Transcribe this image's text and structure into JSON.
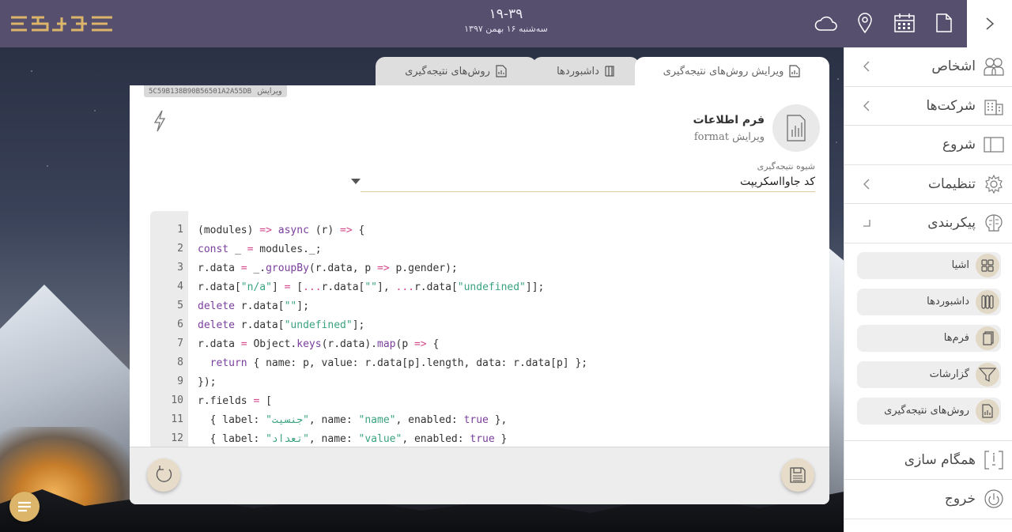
{
  "topbar": {
    "logo_text": "",
    "time": "۱۹-۳۹",
    "date": "سه‌شنبه ۱۶ بهمن ۱۳۹۷",
    "icons": [
      "document-icon",
      "calendar-icon",
      "location-pin-icon",
      "cloud-icon"
    ],
    "collapse_icon": "chevron-right-icon"
  },
  "tabs": [
    {
      "label": "ویرایش روش‌های نتیجه‌گیری",
      "icon": "report-edit-icon",
      "active": true
    },
    {
      "label": "داشبوردها",
      "icon": "dashboard-icon",
      "active": false
    },
    {
      "label": "روش‌های نتیجه‌گیری",
      "icon": "report-icon",
      "active": false
    }
  ],
  "panel": {
    "version_label": "ویرایش",
    "version_hash": "5C59B138B90B56501A2A55DB",
    "form_title": "فرم اطلاعات",
    "form_subtitle": "ویرایش format",
    "field_label": "شیوه نتیجه‌گیری",
    "field_value": "کد جاوااسکریپت"
  },
  "editor": {
    "line_numbers": [
      "1",
      "2",
      "3",
      "4",
      "5",
      "6",
      "7",
      "8",
      "9",
      "10",
      "11",
      "12"
    ]
  },
  "sidebar": {
    "items": [
      {
        "label": "اشخاص",
        "icon": "people-icon",
        "has_arrow": true
      },
      {
        "label": "شرکت‌ها",
        "icon": "building-icon",
        "has_arrow": true
      },
      {
        "label": "شروع",
        "icon": "panel-icon",
        "has_arrow": false
      },
      {
        "label": "تنظیمات",
        "icon": "gear-icon",
        "has_arrow": true
      },
      {
        "label": "پیکربندی",
        "icon": "brain-icon",
        "has_arrow": true
      }
    ],
    "sub_items": [
      {
        "label": "اشیا",
        "icon": "grid-icon"
      },
      {
        "label": "داشبوردها",
        "icon": "dashboard-icon"
      },
      {
        "label": "فرم‌ها",
        "icon": "forms-icon"
      },
      {
        "label": "گزارشات",
        "icon": "filter-icon"
      },
      {
        "label": "روش‌های نتیجه‌گیری",
        "icon": "report-icon"
      }
    ],
    "bottom_items": [
      {
        "label": "همگام سازی",
        "icon": "sync-icon"
      },
      {
        "label": "خروج",
        "icon": "power-icon"
      }
    ]
  },
  "colors": {
    "topbar": "#56506e",
    "accent": "#dcb46a",
    "keyword": "#7a3e9d",
    "string": "#3aa37e",
    "operator": "#d4478a"
  }
}
